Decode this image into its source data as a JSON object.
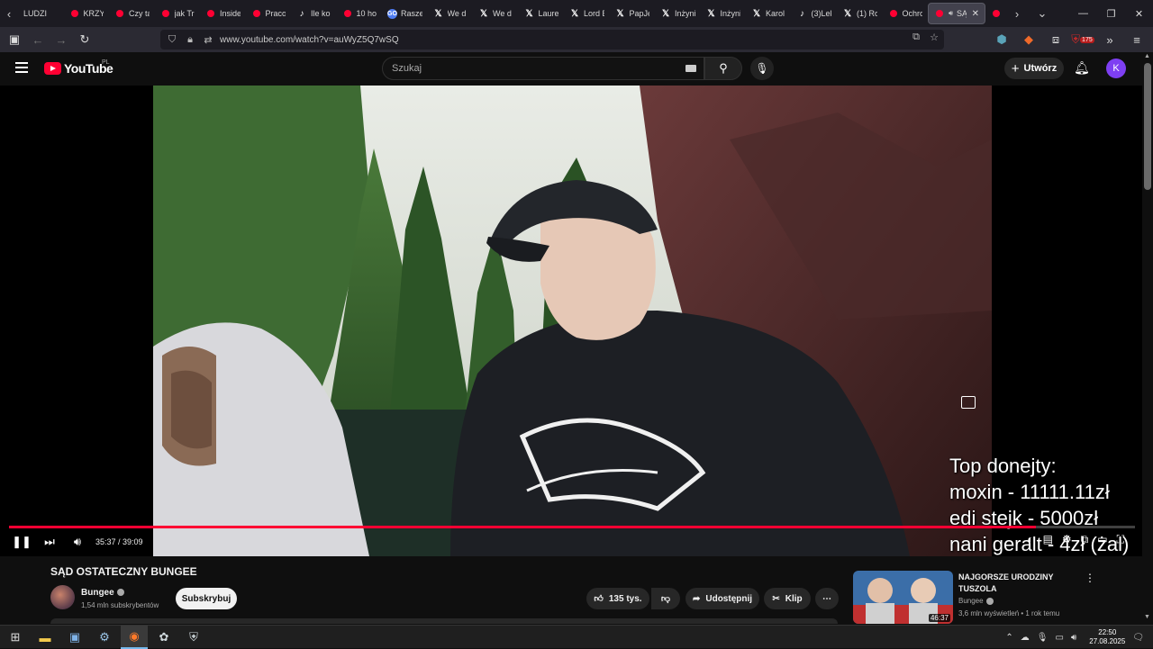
{
  "browser": {
    "tabs": [
      {
        "label": "LUDZI",
        "icon": "none"
      },
      {
        "label": "KRZYŻ",
        "icon": "youtube"
      },
      {
        "label": "Czy ta",
        "icon": "youtube"
      },
      {
        "label": "jak Tr",
        "icon": "youtube"
      },
      {
        "label": "Inside",
        "icon": "youtube"
      },
      {
        "label": "Praco",
        "icon": "youtube"
      },
      {
        "label": "Ile ko",
        "icon": "tiktok"
      },
      {
        "label": "10 ho",
        "icon": "youtube"
      },
      {
        "label": "Rasze",
        "icon": "go"
      },
      {
        "label": "We d",
        "icon": "x"
      },
      {
        "label": "We d",
        "icon": "x"
      },
      {
        "label": "Laure",
        "icon": "x"
      },
      {
        "label": "Lord E",
        "icon": "x"
      },
      {
        "label": "PapJe",
        "icon": "x"
      },
      {
        "label": "Inżyni",
        "icon": "x"
      },
      {
        "label": "Inżyni",
        "icon": "x"
      },
      {
        "label": "Karol",
        "icon": "x"
      },
      {
        "label": "(3)Lek",
        "icon": "tiktok"
      },
      {
        "label": "(1) Ro",
        "icon": "x"
      },
      {
        "label": "Ochro",
        "icon": "youtube"
      },
      {
        "label": "SĄ",
        "icon": "youtube",
        "active": true
      },
      {
        "label": "THE",
        "icon": "youtube"
      }
    ],
    "url": "www.youtube.com/watch?v=auWyZ5Q7wSQ",
    "extension_badge": "175"
  },
  "yt": {
    "logo_text": "YouTube",
    "country": "PL",
    "search_placeholder": "Szukaj",
    "create_label": "Utwórz",
    "avatar_letter": "K"
  },
  "player": {
    "current_time": "35:37",
    "duration": "39:09",
    "time_display": "35:37 / 39:09",
    "progress_fraction": 0.912,
    "overlay_lines": [
      "Top donejty:",
      "moxin - 11111.11zł",
      "edi stejk - 5000zł",
      "nani geralt - 4zł (żal)"
    ]
  },
  "video": {
    "title": "SĄD OSTATECZNY BUNGEE",
    "channel": "Bungee",
    "subscribers": "1,54 mln subskrybentów",
    "subscribe_label": "Subskrybuj",
    "likes": "135 tys.",
    "share_label": "Udostępnij",
    "clip_label": "Klip"
  },
  "recommended": {
    "title": "NAJGORSZE URODZINY TUSZOLA",
    "channel": "Bungee",
    "meta": "3,6 mln wyświetleń • 1 rok temu",
    "duration": "46:37"
  },
  "taskbar": {
    "time": "22:50",
    "date": "27.08.2025"
  },
  "colors": {
    "yt_red": "#ff0033",
    "background": "#0f0f0f",
    "avatar": "#7e3ff2"
  }
}
